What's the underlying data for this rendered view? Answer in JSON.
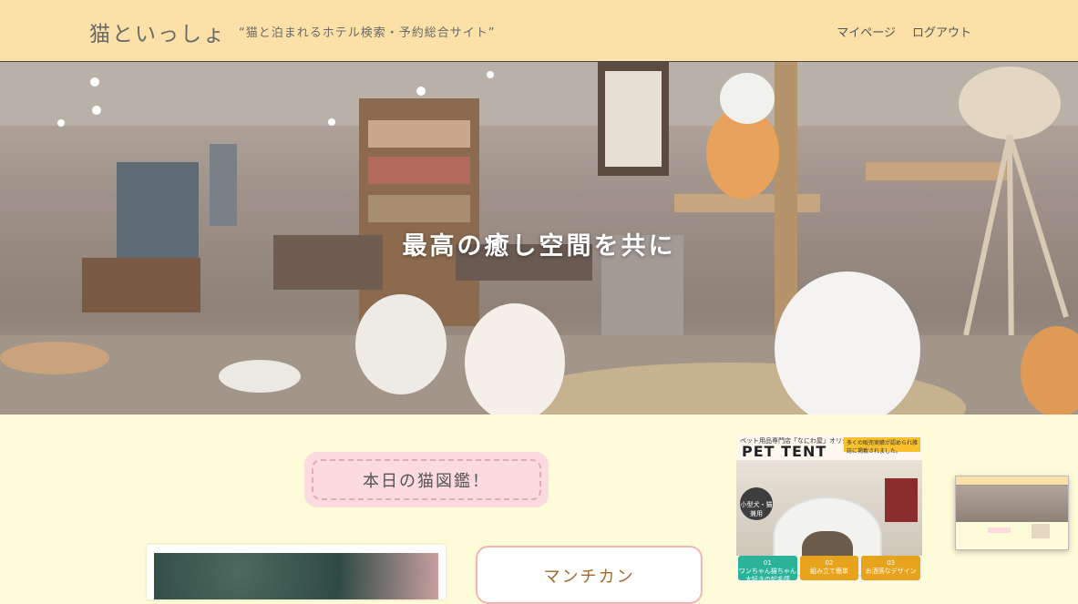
{
  "header": {
    "logo": "猫といっしょ",
    "tagline": "“猫と泊まれるホテル検索・予約総合サイト”",
    "nav": [
      {
        "label": "マイページ"
      },
      {
        "label": "ログアウト"
      }
    ]
  },
  "hero": {
    "title": "最高の癒し空間を共に"
  },
  "main": {
    "section_badge": "本日の猫図鑑！",
    "cat_name": "マンチカン"
  },
  "ad": {
    "top_text": "ペット用品専門店「なにわ屋」オリジナル",
    "title": "PET TENT",
    "note": "多くの販売実績が認められ雑誌に掲載されました。",
    "round_label": "小型犬・猫兼用",
    "features": [
      {
        "num": "01",
        "text": "ワンちゃん猫ちゃん大好きの起毛感"
      },
      {
        "num": "02",
        "text": "組み立て簡単"
      },
      {
        "num": "03",
        "text": "お洒落なデザイン"
      }
    ]
  },
  "colors": {
    "header_bg": "#fbe0a7",
    "page_bg": "#fefcd8",
    "badge_bg": "#fbdbe0",
    "accent_text": "#a06a2e"
  }
}
